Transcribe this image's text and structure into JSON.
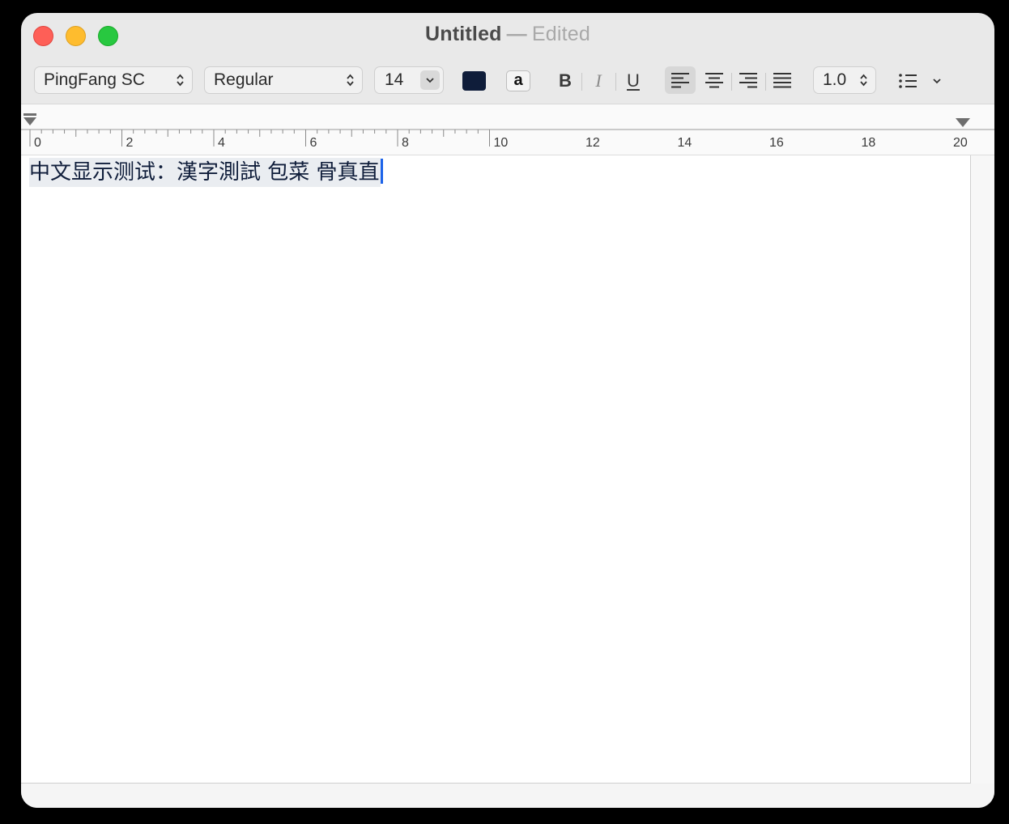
{
  "window": {
    "title": "Untitled",
    "separator": "—",
    "status": "Edited"
  },
  "toolbar": {
    "font_family": "PingFang SC",
    "font_style": "Regular",
    "font_size": "14",
    "text_color": "#0f1d3a",
    "background_label": "a",
    "bold_label": "B",
    "italic_label": "I",
    "underline_label": "U",
    "alignment_selected": "left",
    "line_spacing": "1.0",
    "list_icon": "bulleted-list-icon"
  },
  "ruler": {
    "labels": [
      "0",
      "2",
      "4",
      "6",
      "8",
      "10",
      "12",
      "14",
      "16",
      "18",
      "20"
    ]
  },
  "document": {
    "text": "中文显示测试：漢字測試 包菜 骨真直"
  },
  "colors": {
    "close": "#fe5f57",
    "minimize": "#febc2e",
    "zoom": "#28c840",
    "caret": "#1d63e9",
    "selection": "#eaedf1"
  }
}
